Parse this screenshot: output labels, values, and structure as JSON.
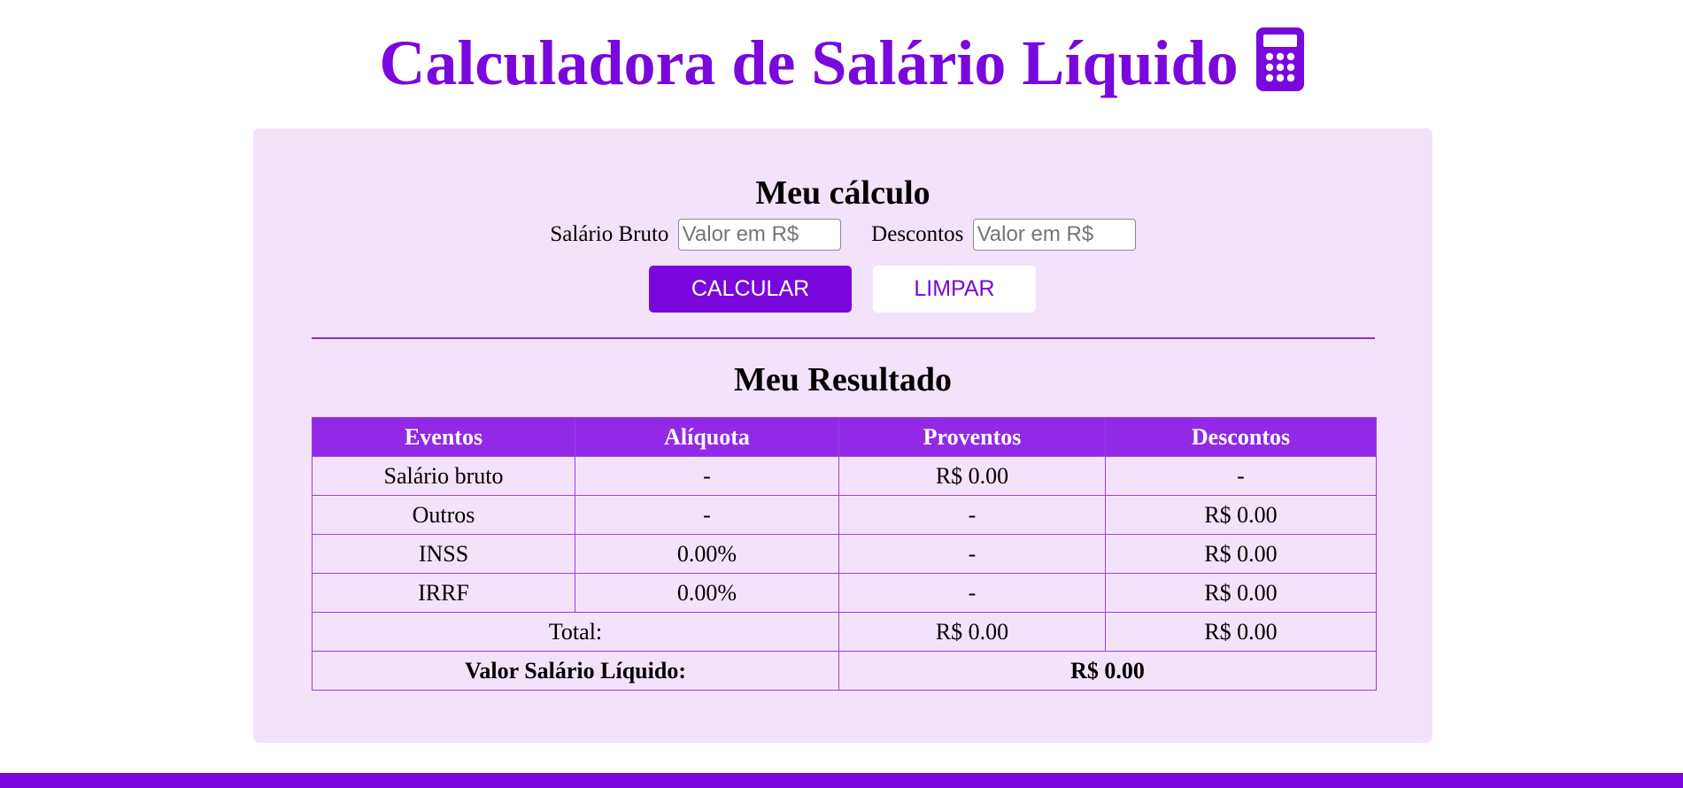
{
  "header": {
    "title": "Calculadora de Salário Líquido",
    "icon": "calculator-icon"
  },
  "calculator": {
    "title": "Meu cálculo",
    "gross_salary_label": "Salário Bruto",
    "gross_salary_placeholder": "Valor em R$",
    "gross_salary_value": "",
    "discounts_label": "Descontos",
    "discounts_placeholder": "Valor em R$",
    "discounts_value": "",
    "calculate_button": "CALCULAR",
    "clear_button": "LIMPAR"
  },
  "result": {
    "title": "Meu Resultado",
    "columns": [
      "Eventos",
      "Alíquota",
      "Proventos",
      "Descontos"
    ],
    "rows": [
      {
        "event": "Salário bruto",
        "rate": "-",
        "earnings": "R$ 0.00",
        "discounts": "-"
      },
      {
        "event": "Outros",
        "rate": "-",
        "earnings": "-",
        "discounts": "R$ 0.00"
      },
      {
        "event": "INSS",
        "rate": "0.00%",
        "earnings": "-",
        "discounts": "R$ 0.00"
      },
      {
        "event": "IRRF",
        "rate": "0.00%",
        "earnings": "-",
        "discounts": "R$ 0.00"
      }
    ],
    "total": {
      "label": "Total:",
      "earnings": "R$ 0.00",
      "discounts": "R$ 0.00"
    },
    "net": {
      "label": "Valor Salário Líquido:",
      "value": "R$ 0.00"
    }
  },
  "colors": {
    "brand": "#7a07dc",
    "table_header": "#9129e6",
    "card_background": "#f2e3fa"
  }
}
